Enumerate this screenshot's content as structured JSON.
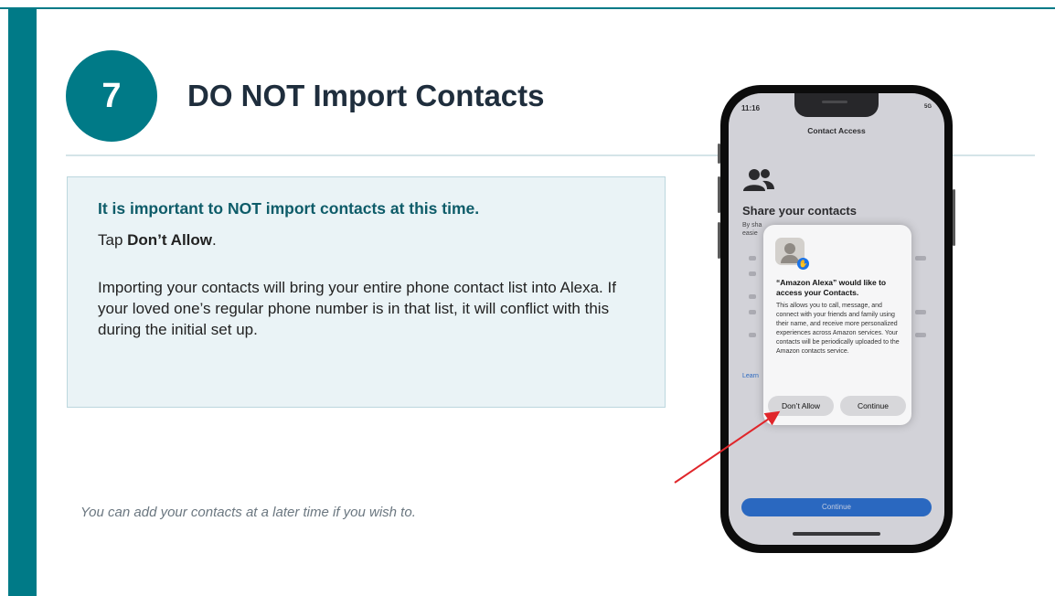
{
  "slide": {
    "step_number": "7",
    "title": "DO NOT Import Contacts",
    "box": {
      "heading": "It is important to NOT import contacts at this time.",
      "tap_prefix": "Tap ",
      "tap_bold": "Don’t Allow",
      "tap_suffix": ".",
      "body": "Importing your contacts will bring your entire phone contact list into Alexa. If your loved one’s regular phone number is in that list, it will conflict with this during the initial set up."
    },
    "footnote": "You can add your contacts at a later time if you wish to."
  },
  "phone": {
    "status_time": "11:16",
    "status_right": "5G",
    "nav_title": "Contact Access",
    "share_title": "Share your contacts",
    "bg_partial_intro": "By sha",
    "bg_partial_intro2": "easie",
    "bg_partial_learn": "Learn",
    "bottom_button": "Continue",
    "dialog": {
      "title": "“Amazon Alexa” would like to access your Contacts.",
      "body": "This allows you to call, message, and connect with your friends and family using their name, and receive more personalized experiences across Amazon services. Your contacts will be periodically uploaded to the Amazon contacts service.",
      "deny_label": "Don’t Allow",
      "allow_label": "Continue"
    }
  },
  "colors": {
    "accent": "#007a87",
    "heading_teal": "#0e5c69",
    "box_bg": "#eaf3f6",
    "arrow": "#e0262b",
    "ios_blue": "#1063d4"
  }
}
